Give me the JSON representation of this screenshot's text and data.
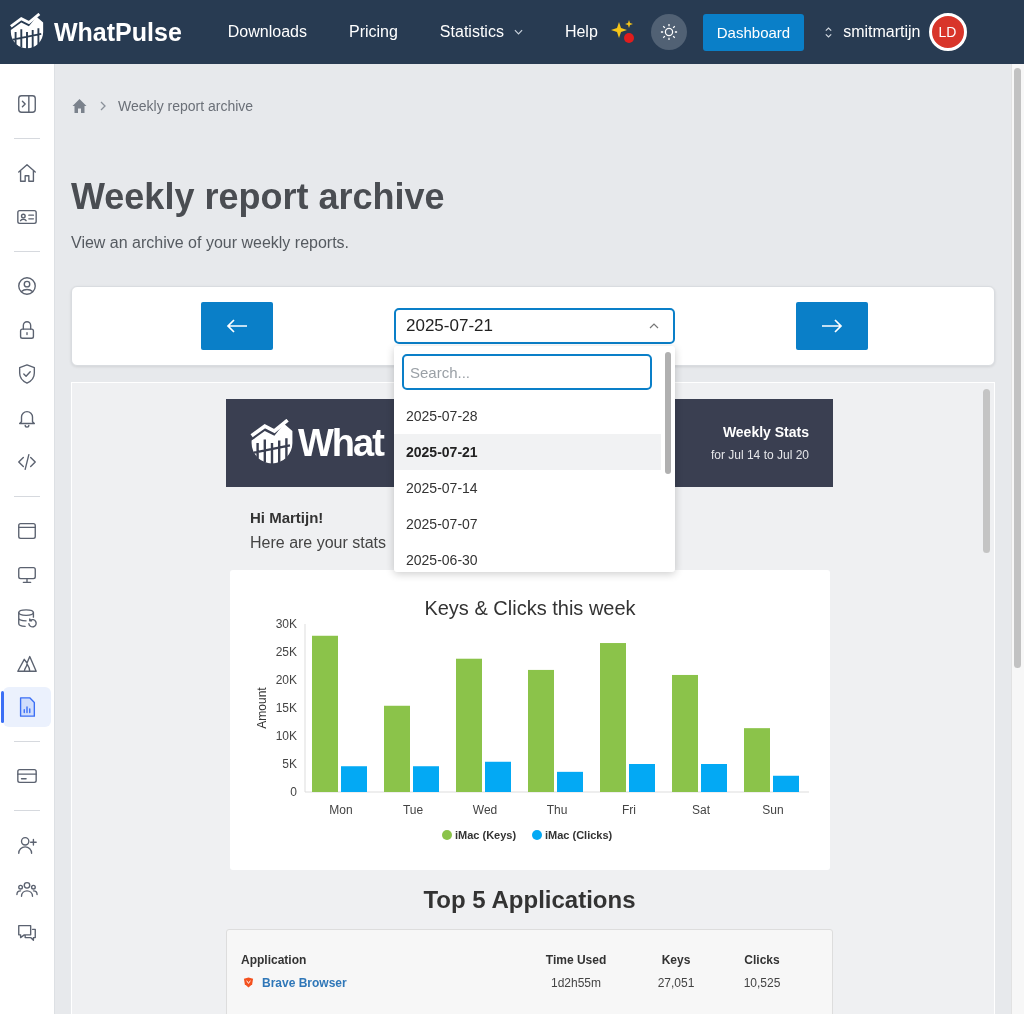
{
  "header": {
    "brand": "WhatPulse",
    "nav": [
      {
        "label": "Downloads",
        "kind": "link"
      },
      {
        "label": "Pricing",
        "kind": "link"
      },
      {
        "label": "Statistics",
        "kind": "menu"
      },
      {
        "label": "Help",
        "kind": "link"
      }
    ],
    "notification": true,
    "dashboard_button": "Dashboard",
    "username": "smitmartijn",
    "avatar": "LD"
  },
  "sidebar": {
    "groups": [
      [
        {
          "selected": false
        }
      ],
      [
        {
          "selected": false
        },
        {
          "selected": false
        }
      ],
      [
        {
          "selected": false
        },
        {
          "selected": false
        },
        {
          "selected": false
        },
        {
          "selected": false
        },
        {
          "selected": false
        }
      ],
      [
        {
          "selected": false
        },
        {
          "selected": false
        },
        {
          "selected": false
        },
        {
          "selected": false
        },
        {
          "selected": true
        }
      ],
      [
        {
          "selected": false
        }
      ],
      [
        {
          "selected": false
        },
        {
          "selected": false
        },
        {
          "selected": false
        }
      ]
    ]
  },
  "breadcrumb": [
    "Weekly report archive"
  ],
  "title": "Weekly report archive",
  "subtitle": "View an archive of your weekly reports.",
  "week_picker": {
    "value": "2025-07-21",
    "expanded": true,
    "search_placeholder": "Search...",
    "options": [
      {
        "label": "2025-07-28",
        "selected": false,
        "hovered": false
      },
      {
        "label": "2025-07-21",
        "selected": true,
        "hovered": true
      },
      {
        "label": "2025-07-14",
        "selected": false,
        "hovered": false
      },
      {
        "label": "2025-07-07",
        "selected": false,
        "hovered": false
      },
      {
        "label": "2025-06-30",
        "selected": false,
        "hovered": false
      }
    ]
  },
  "report": {
    "logo_text": "What",
    "heading": "Weekly Stats",
    "period": "for Jul 14 to Jul 20",
    "greeting": "Hi Martijn!",
    "intro": "Here are your stats",
    "chart_data": {
      "type": "bar",
      "title": "Keys & Clicks this week",
      "ylabel": "Amount",
      "categories": [
        "Mon",
        "Tue",
        "Wed",
        "Thu",
        "Fri",
        "Sat",
        "Sun"
      ],
      "series": [
        {
          "name": "iMac (Keys)",
          "color": "#8bc34a",
          "values": [
            27900,
            15400,
            23800,
            21800,
            26600,
            20900,
            11400
          ]
        },
        {
          "name": "iMac (Clicks)",
          "color": "#03a9f4",
          "values": [
            4600,
            4600,
            5400,
            3600,
            5000,
            5000,
            2900
          ]
        }
      ],
      "ylim": [
        0,
        30000
      ],
      "legend": "bottom",
      "yticks": [
        {
          "value": 0,
          "label": "0"
        },
        {
          "value": 5000,
          "label": "5K"
        },
        {
          "value": 10000,
          "label": "10K"
        },
        {
          "value": 15000,
          "label": "15K"
        },
        {
          "value": 20000,
          "label": "20K"
        },
        {
          "value": 25000,
          "label": "25K"
        },
        {
          "value": 30000,
          "label": "30K"
        }
      ]
    },
    "apps_title": "Top 5 Applications",
    "apps_columns": [
      "Application",
      "Time Used",
      "Keys",
      "Clicks"
    ],
    "apps": [
      {
        "name": "Brave Browser",
        "time": "1d2h55m",
        "keys": "27,051",
        "clicks": "10,525"
      }
    ]
  }
}
